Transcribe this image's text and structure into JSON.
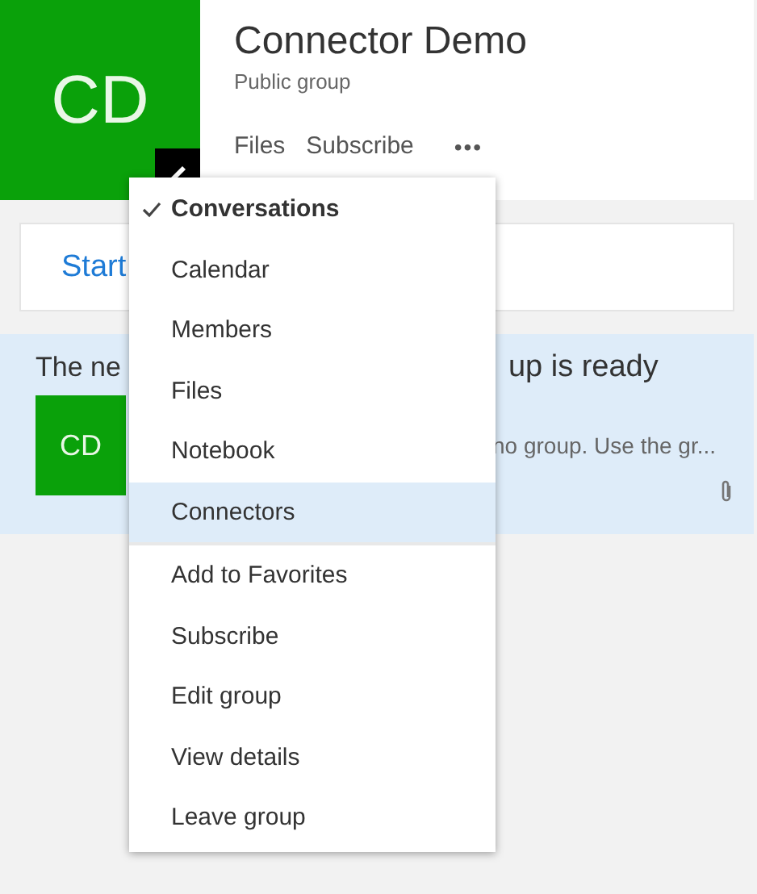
{
  "group": {
    "initials": "CD",
    "name": "Connector Demo",
    "privacy": "Public group"
  },
  "nav": [
    {
      "label": "Files"
    },
    {
      "label": "Subscribe"
    },
    {
      "label": "•••"
    }
  ],
  "composer": {
    "text": "Start"
  },
  "banner": {
    "title_start": "The ne",
    "title_end": "up is ready",
    "initials": "CD",
    "preview": "no group. Use the gr..."
  },
  "menu": {
    "sections": [
      [
        {
          "label": "Conversations",
          "checked": true,
          "selected": false
        },
        {
          "label": "Calendar",
          "checked": false,
          "selected": false
        },
        {
          "label": "Members",
          "checked": false,
          "selected": false
        },
        {
          "label": "Files",
          "checked": false,
          "selected": false
        },
        {
          "label": "Notebook",
          "checked": false,
          "selected": false
        },
        {
          "label": "Connectors",
          "checked": false,
          "selected": true
        }
      ],
      [
        {
          "label": "Add to Favorites",
          "checked": false,
          "selected": false
        },
        {
          "label": "Subscribe",
          "checked": false,
          "selected": false
        },
        {
          "label": "Edit group",
          "checked": false,
          "selected": false
        },
        {
          "label": "View details",
          "checked": false,
          "selected": false
        },
        {
          "label": "Leave group",
          "checked": false,
          "selected": false
        }
      ]
    ]
  }
}
